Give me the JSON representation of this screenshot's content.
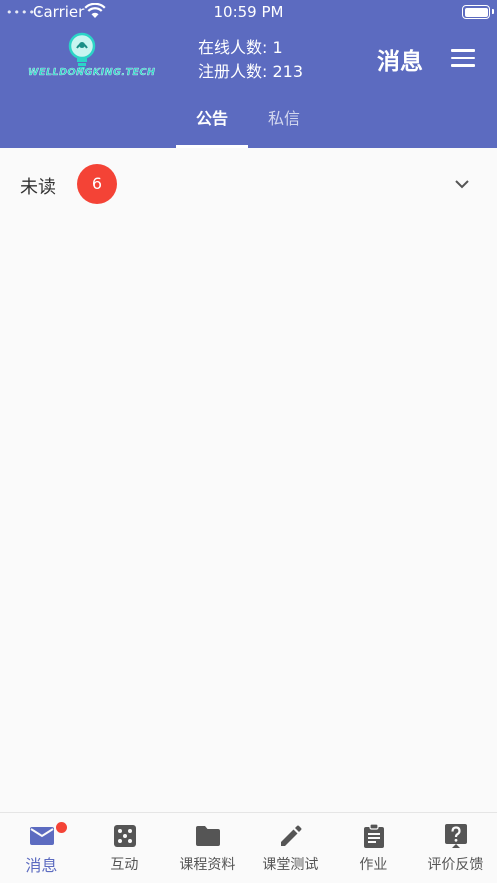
{
  "status_bar": {
    "signal": "•••••",
    "carrier": "Carrier",
    "time": "10:59 PM"
  },
  "logo": {
    "text": "WELLDONGKING.TECH"
  },
  "stats": {
    "online": "在线人数: 1",
    "registered": "注册人数: 213"
  },
  "header": {
    "title": "消息"
  },
  "tabs": [
    {
      "label": "公告",
      "active": true
    },
    {
      "label": "私信",
      "active": false
    }
  ],
  "unread": {
    "label": "未读",
    "count": "6"
  },
  "bottom_nav": [
    {
      "label": "消息",
      "icon": "mail-icon",
      "active": true,
      "has_dot": true
    },
    {
      "label": "互动",
      "icon": "dice-icon"
    },
    {
      "label": "课程资料",
      "icon": "folder-icon"
    },
    {
      "label": "课堂测试",
      "icon": "pencil-icon"
    },
    {
      "label": "作业",
      "icon": "clipboard-icon"
    },
    {
      "label": "评价反馈",
      "icon": "help-icon"
    }
  ],
  "colors": {
    "primary": "#5c6bc0",
    "badge": "#f44336",
    "background": "#fafafa"
  }
}
